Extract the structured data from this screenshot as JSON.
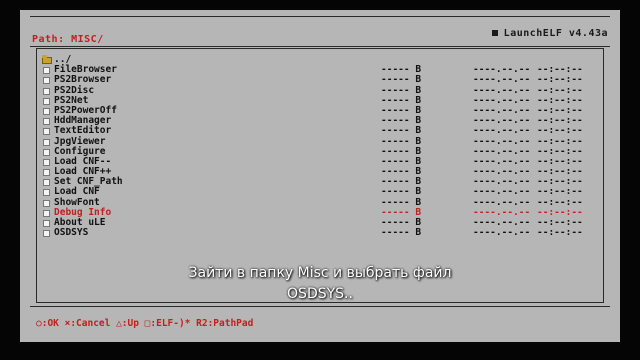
{
  "header": {
    "path_label": "Path: MISC/",
    "app_title": "LaunchELF v4.43a"
  },
  "files": [
    {
      "name": "../",
      "icon": "folder-icon",
      "size": "",
      "date": "",
      "time": "",
      "selected": false
    },
    {
      "name": "FileBrowser",
      "icon": "file-icon",
      "size": "----- B",
      "date": "----.--.--",
      "time": "--:--:--",
      "selected": false
    },
    {
      "name": "PS2Browser",
      "icon": "file-icon",
      "size": "----- B",
      "date": "----.--.--",
      "time": "--:--:--",
      "selected": false
    },
    {
      "name": "PS2Disc",
      "icon": "file-icon",
      "size": "----- B",
      "date": "----.--.--",
      "time": "--:--:--",
      "selected": false
    },
    {
      "name": "PS2Net",
      "icon": "file-icon",
      "size": "----- B",
      "date": "----.--.--",
      "time": "--:--:--",
      "selected": false
    },
    {
      "name": "PS2PowerOff",
      "icon": "file-icon",
      "size": "----- B",
      "date": "----.--.--",
      "time": "--:--:--",
      "selected": false
    },
    {
      "name": "HddManager",
      "icon": "file-icon",
      "size": "----- B",
      "date": "----.--.--",
      "time": "--:--:--",
      "selected": false
    },
    {
      "name": "TextEditor",
      "icon": "file-icon",
      "size": "----- B",
      "date": "----.--.--",
      "time": "--:--:--",
      "selected": false
    },
    {
      "name": "JpgViewer",
      "icon": "file-icon",
      "size": "----- B",
      "date": "----.--.--",
      "time": "--:--:--",
      "selected": false
    },
    {
      "name": "Configure",
      "icon": "file-icon",
      "size": "----- B",
      "date": "----.--.--",
      "time": "--:--:--",
      "selected": false
    },
    {
      "name": "Load CNF--",
      "icon": "file-icon",
      "size": "----- B",
      "date": "----.--.--",
      "time": "--:--:--",
      "selected": false
    },
    {
      "name": "Load CNF++",
      "icon": "file-icon",
      "size": "----- B",
      "date": "----.--.--",
      "time": "--:--:--",
      "selected": false
    },
    {
      "name": "Set CNF_Path",
      "icon": "file-icon",
      "size": "----- B",
      "date": "----.--.--",
      "time": "--:--:--",
      "selected": false
    },
    {
      "name": "Load CNF",
      "icon": "file-icon",
      "size": "----- B",
      "date": "----.--.--",
      "time": "--:--:--",
      "selected": false
    },
    {
      "name": "ShowFont",
      "icon": "file-icon",
      "size": "----- B",
      "date": "----.--.--",
      "time": "--:--:--",
      "selected": false
    },
    {
      "name": "Debug Info",
      "icon": "file-icon",
      "size": "----- B",
      "date": "----.--.--",
      "time": "--:--:--",
      "selected": true
    },
    {
      "name": "About uLE",
      "icon": "file-icon",
      "size": "----- B",
      "date": "----.--.--",
      "time": "--:--:--",
      "selected": false
    },
    {
      "name": "OSDSYS",
      "icon": "file-icon",
      "size": "----- B",
      "date": "----.--.--",
      "time": "--:--:--",
      "selected": false
    }
  ],
  "footer": {
    "hint": "○:OK ×:Cancel △:Up □:ELF-)* R2:PathPad"
  },
  "caption": {
    "line1": "Зайти в папку Misc и выбрать файл",
    "line2": "OSDSYS.."
  },
  "colors": {
    "background": "#b6b6b6",
    "text": "#111111",
    "highlight": "#c02020"
  }
}
